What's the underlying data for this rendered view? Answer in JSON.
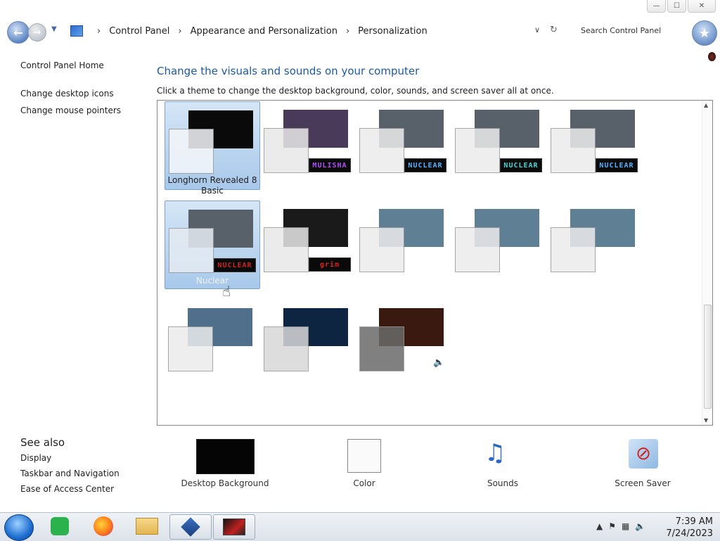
{
  "window": {
    "min": "—",
    "max": "☐",
    "close": "✕"
  },
  "address": {
    "crumbs": [
      "Control Panel",
      "Appearance and Personalization",
      "Personalization"
    ],
    "search_placeholder": "Search Control Panel"
  },
  "sidebar": {
    "home": "Control Panel Home",
    "links": [
      "Change desktop icons",
      "Change mouse pointers"
    ],
    "see_also_title": "See also",
    "see_also": [
      "Display",
      "Taskbar and Navigation",
      "Ease of Access Center"
    ]
  },
  "main": {
    "heading": "Change the visuals and sounds on your computer",
    "subheading": "Click a theme to change the desktop background, color, sounds, and screen saver all at once."
  },
  "themes": [
    {
      "name": "Longhorn Revealed 8 Basic",
      "selected": true,
      "sound_label": "",
      "bg": "#0a0a0a",
      "win": "#f5f7fa"
    },
    {
      "name": "",
      "selected": false,
      "sound_label": "MULISHA",
      "sound_color": "#b04cff",
      "bg": "#4a3a5a",
      "win": "#e8e8e8"
    },
    {
      "name": "",
      "selected": false,
      "sound_label": "NUCLEAR",
      "sound_color": "#4fb3ff",
      "bg": "#58606a",
      "win": "#ececec"
    },
    {
      "name": "",
      "selected": false,
      "sound_label": "NUCLEAR",
      "sound_color": "#3fd6d6",
      "bg": "#58606a",
      "win": "#ececec"
    },
    {
      "name": "",
      "selected": false,
      "sound_label": "NUCLEAR",
      "sound_color": "#4fb3ff",
      "bg": "#58606a",
      "win": "#ececec"
    },
    {
      "name": "Nuclear",
      "selected": true,
      "sound_label": "NUCLEAR",
      "sound_color": "#d02020",
      "bg": "#58606a",
      "win": "#e5ecf3"
    },
    {
      "name": "",
      "selected": false,
      "sound_label": "grim",
      "sound_color": "#e02020",
      "bg": "#1a1a1a",
      "win": "#e8e8e8"
    },
    {
      "name": "",
      "selected": false,
      "sound_label": "",
      "bg": "#5f7f95",
      "win": "#ececec"
    },
    {
      "name": "",
      "selected": false,
      "sound_label": "",
      "bg": "#5f7f95",
      "win": "#ececec"
    },
    {
      "name": "",
      "selected": false,
      "sound_label": "",
      "bg": "#5f7f95",
      "win": "#ececec"
    },
    {
      "name": "",
      "selected": false,
      "sound_label": "",
      "bg": "#4f6f8a",
      "win": "#ececec"
    },
    {
      "name": "",
      "selected": false,
      "sound_label": "",
      "bg": "#0d2540",
      "win": "#d8d8d8"
    },
    {
      "name": "",
      "selected": false,
      "sound_label": "",
      "bg": "#3a1a10",
      "win": "#6a6a6a",
      "speaker": "🔈"
    }
  ],
  "settings": {
    "desktop_background": "Desktop Background",
    "color": "Color",
    "sounds": "Sounds",
    "screen_saver": "Screen Saver"
  },
  "taskbar": {
    "time": "7:39 AM",
    "date": "7/24/2023"
  },
  "colors": {
    "heading": "#1e5aa0",
    "selection": "#a8c8ea"
  }
}
